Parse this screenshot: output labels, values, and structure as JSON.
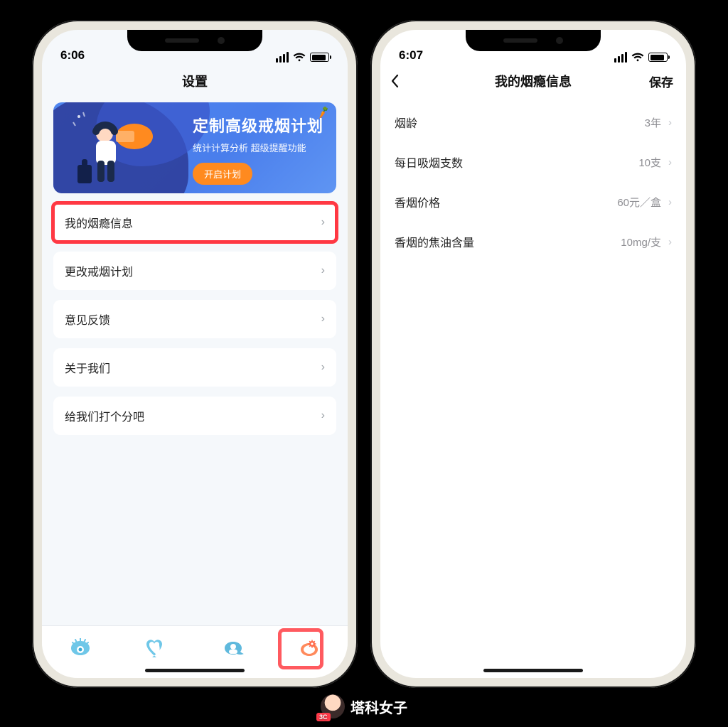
{
  "watermark": "塔科女子",
  "left": {
    "status_time": "6:06",
    "nav_title": "设置",
    "banner": {
      "title": "定制高级戒烟计划",
      "subtitle": "统计计算分析 超级提醒功能",
      "cta": "开启计划"
    },
    "rows": [
      {
        "label": "我的烟瘾信息",
        "highlight": true
      },
      {
        "label": "更改戒烟计划"
      },
      {
        "label": "意见反馈"
      },
      {
        "label": "关于我们"
      },
      {
        "label": "给我们打个分吧"
      }
    ]
  },
  "right": {
    "status_time": "6:07",
    "nav_title": "我的烟瘾信息",
    "save_label": "保存",
    "rows": [
      {
        "label": "烟龄",
        "value": "3年"
      },
      {
        "label": "每日吸烟支数",
        "value": "10支"
      },
      {
        "label": "香烟价格",
        "value": "60元／盒"
      },
      {
        "label": "香烟的焦油含量",
        "value": "10mg/支"
      }
    ]
  }
}
